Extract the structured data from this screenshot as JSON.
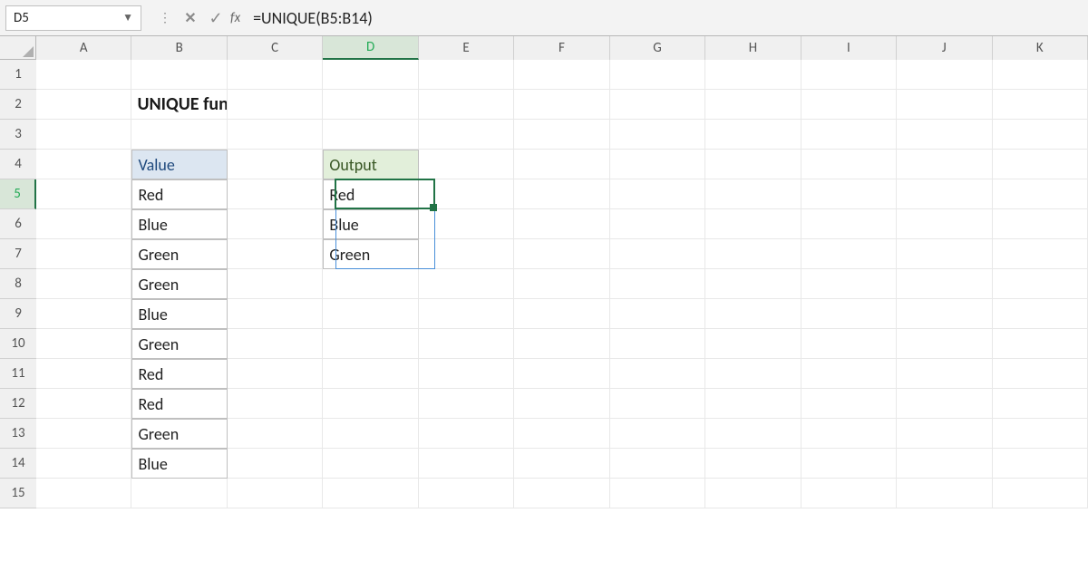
{
  "nameBox": "D5",
  "formula": "=UNIQUE(B5:B14)",
  "columns": [
    "A",
    "B",
    "C",
    "D",
    "E",
    "F",
    "G",
    "H",
    "I",
    "J",
    "K"
  ],
  "activeCol": "D",
  "rowLabels": [
    "1",
    "2",
    "3",
    "4",
    "5",
    "6",
    "7",
    "8",
    "9",
    "10",
    "11",
    "12",
    "13",
    "14",
    "15"
  ],
  "activeRow": "5",
  "cells": {
    "B2": "UNIQUE function",
    "B4": "Value",
    "B5": "Red",
    "B6": "Blue",
    "B7": "Green",
    "B8": "Green",
    "B9": "Blue",
    "B10": "Green",
    "B11": "Red",
    "B12": "Red",
    "B13": "Green",
    "B14": "Blue",
    "D4": "Output",
    "D5": "Red",
    "D6": "Blue",
    "D7": "Green"
  },
  "selection": {
    "activeCell": "D5",
    "spillRange": "D5:D7"
  },
  "chart_data": {
    "type": "table",
    "title": "UNIQUE function",
    "input_header": "Value",
    "input_values": [
      "Red",
      "Blue",
      "Green",
      "Green",
      "Blue",
      "Green",
      "Red",
      "Red",
      "Green",
      "Blue"
    ],
    "output_header": "Output",
    "output_values": [
      "Red",
      "Blue",
      "Green"
    ],
    "formula": "=UNIQUE(B5:B14)"
  }
}
